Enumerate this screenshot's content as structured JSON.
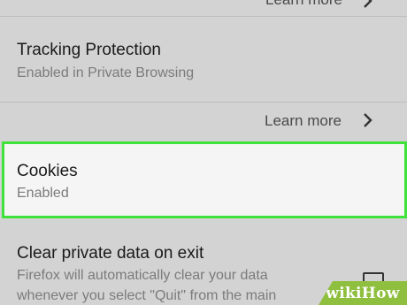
{
  "top_row": {
    "learn_more": "Learn more"
  },
  "tracking": {
    "title": "Tracking Protection",
    "subtitle": "Enabled in Private Browsing"
  },
  "tracking_link": {
    "learn_more": "Learn more"
  },
  "cookies": {
    "title": "Cookies",
    "subtitle": "Enabled"
  },
  "clear_data": {
    "title": "Clear private data on exit",
    "desc_line1": "Firefox will automatically clear your data",
    "desc_line2": "whenever you select \"Quit\" from the main",
    "checked": false
  },
  "watermark": {
    "text": "wikiHow"
  },
  "colors": {
    "highlight_border": "#3fe23a",
    "background": "#d3d3d3",
    "selected_bg": "#f5f5f5"
  },
  "icons": [
    "chevron-right-icon",
    "chevron-right-icon"
  ]
}
